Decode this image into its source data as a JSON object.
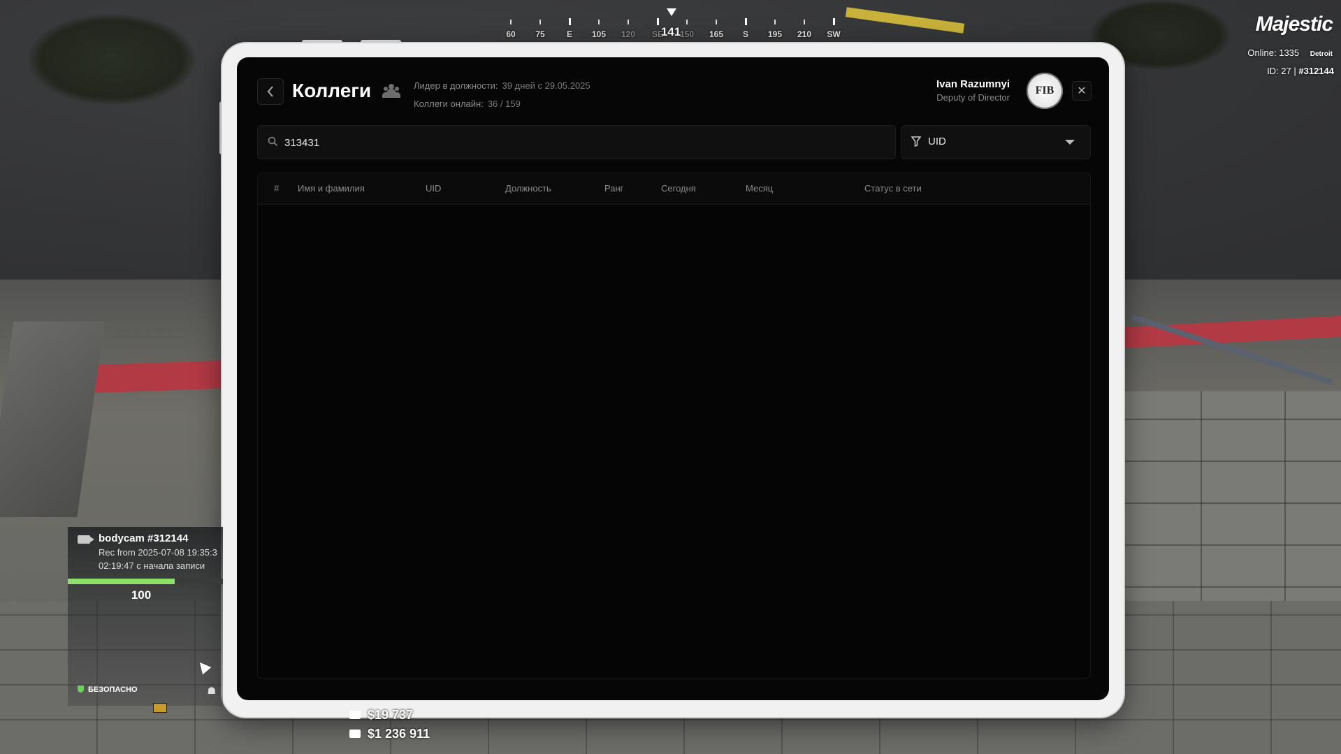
{
  "compass": {
    "heading": "141",
    "labels": [
      "60",
      "75",
      "E",
      "105",
      "120",
      "SE",
      "150",
      "165",
      "S",
      "195",
      "210",
      "SW"
    ]
  },
  "server": {
    "brand": "Majestic",
    "online_label": "Online:",
    "online_count": "1335",
    "city": "Detroit",
    "id_label": "ID: 27 |",
    "id_value": "#312144"
  },
  "header": {
    "title": "Коллеги",
    "leader_label": "Лидер в должности:",
    "leader_value": "39 дней  с 29.05.2025",
    "online_label": "Коллеги онлайн:",
    "online_value": "36 / 159",
    "user_name": "Ivan Razumnyi",
    "user_role": "Deputy of Director",
    "logo_text": "FIB",
    "close_symbol": "✕",
    "back_symbol": "‹"
  },
  "search": {
    "value": "313431",
    "placeholder": ""
  },
  "filter": {
    "selected": "UID"
  },
  "table": {
    "columns": [
      "#",
      "Имя и фамилия",
      "UID",
      "Должность",
      "Ранг",
      "Сегодня",
      "Месяц",
      "Статус в сети"
    ],
    "rows": []
  },
  "bodycam": {
    "title": "bodycam #312144",
    "rec_line": "Rec from 2025-07-08 19:35:3",
    "elapsed_line": "02:19:47 с начала записи",
    "health": "100",
    "health_fraction": 0.69,
    "status": "БЕЗОПАСНО"
  },
  "money": {
    "cash": "$19 737",
    "bank": "$1 236 911"
  },
  "colors": {
    "accent_green": "#8fe06a",
    "curb_red": "#b23a45",
    "brand_pink": "#e0307c"
  }
}
